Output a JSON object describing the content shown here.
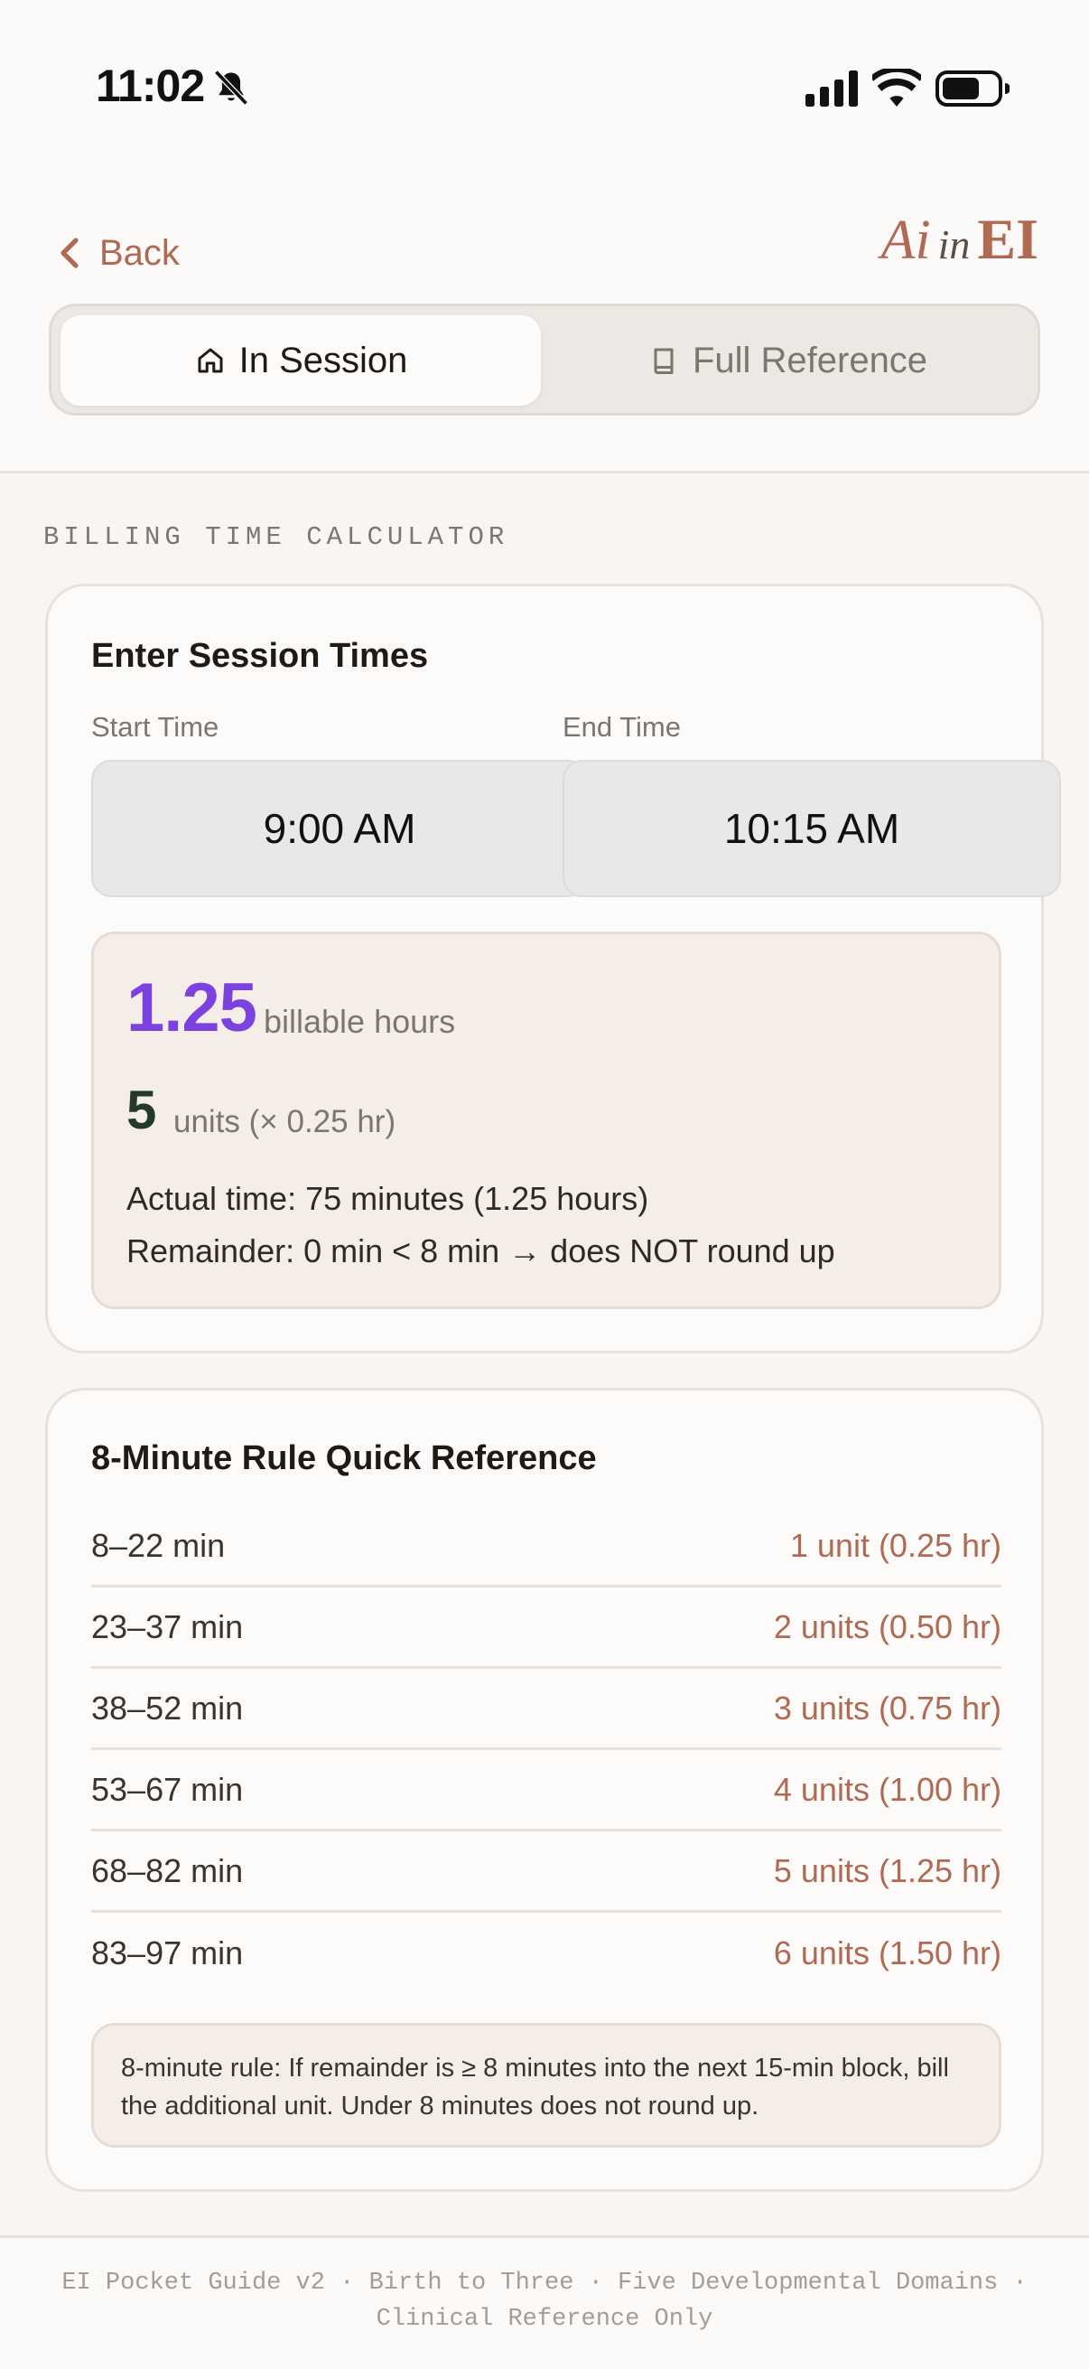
{
  "status_bar": {
    "time": "11:02",
    "icons": [
      "bell-slash-icon",
      "signal-icon",
      "wifi-icon",
      "battery-icon"
    ]
  },
  "header": {
    "back_label": "Back",
    "logo": {
      "part1": "Ai",
      "part2": "in",
      "part3": "EI"
    },
    "tabs": [
      {
        "label": "In Session",
        "icon": "home-icon",
        "active": true
      },
      {
        "label": "Full Reference",
        "icon": "book-icon",
        "active": false
      }
    ]
  },
  "section_label": "BILLING TIME CALCULATOR",
  "calculator": {
    "title": "Enter Session Times",
    "start_label": "Start Time",
    "end_label": "End Time",
    "start_value": "9:00 AM",
    "end_value": "10:15 AM",
    "result": {
      "hours": "1.25",
      "hours_label": "billable hours",
      "units": "5",
      "units_label": "units (× 0.25 hr)",
      "actual_time": "Actual time: 75 minutes (1.25 hours)",
      "remainder": "Remainder: 0 min < 8 min → does NOT round up"
    }
  },
  "reference": {
    "title": "8-Minute Rule Quick Reference",
    "rows": [
      {
        "range": "8–22 min",
        "units": "1 unit (0.25 hr)"
      },
      {
        "range": "23–37 min",
        "units": "2 units (0.50 hr)"
      },
      {
        "range": "38–52 min",
        "units": "3 units (0.75 hr)"
      },
      {
        "range": "53–67 min",
        "units": "4 units (1.00 hr)"
      },
      {
        "range": "68–82 min",
        "units": "5 units (1.25 hr)"
      },
      {
        "range": "83–97 min",
        "units": "6 units (1.50 hr)"
      }
    ],
    "note": "8-minute rule: If remainder is ≥ 8 minutes into the next 15-min block, bill the additional unit. Under 8 minutes does not round up."
  },
  "footer": {
    "line1": "EI Pocket Guide v2 · Birth to Three · Five Developmental Domains ·",
    "line2": "Clinical Reference Only"
  },
  "colors": {
    "accent": "#b06a54",
    "hours": "#7b42e0",
    "units": "#22392c",
    "background": "#f8f5f2"
  }
}
